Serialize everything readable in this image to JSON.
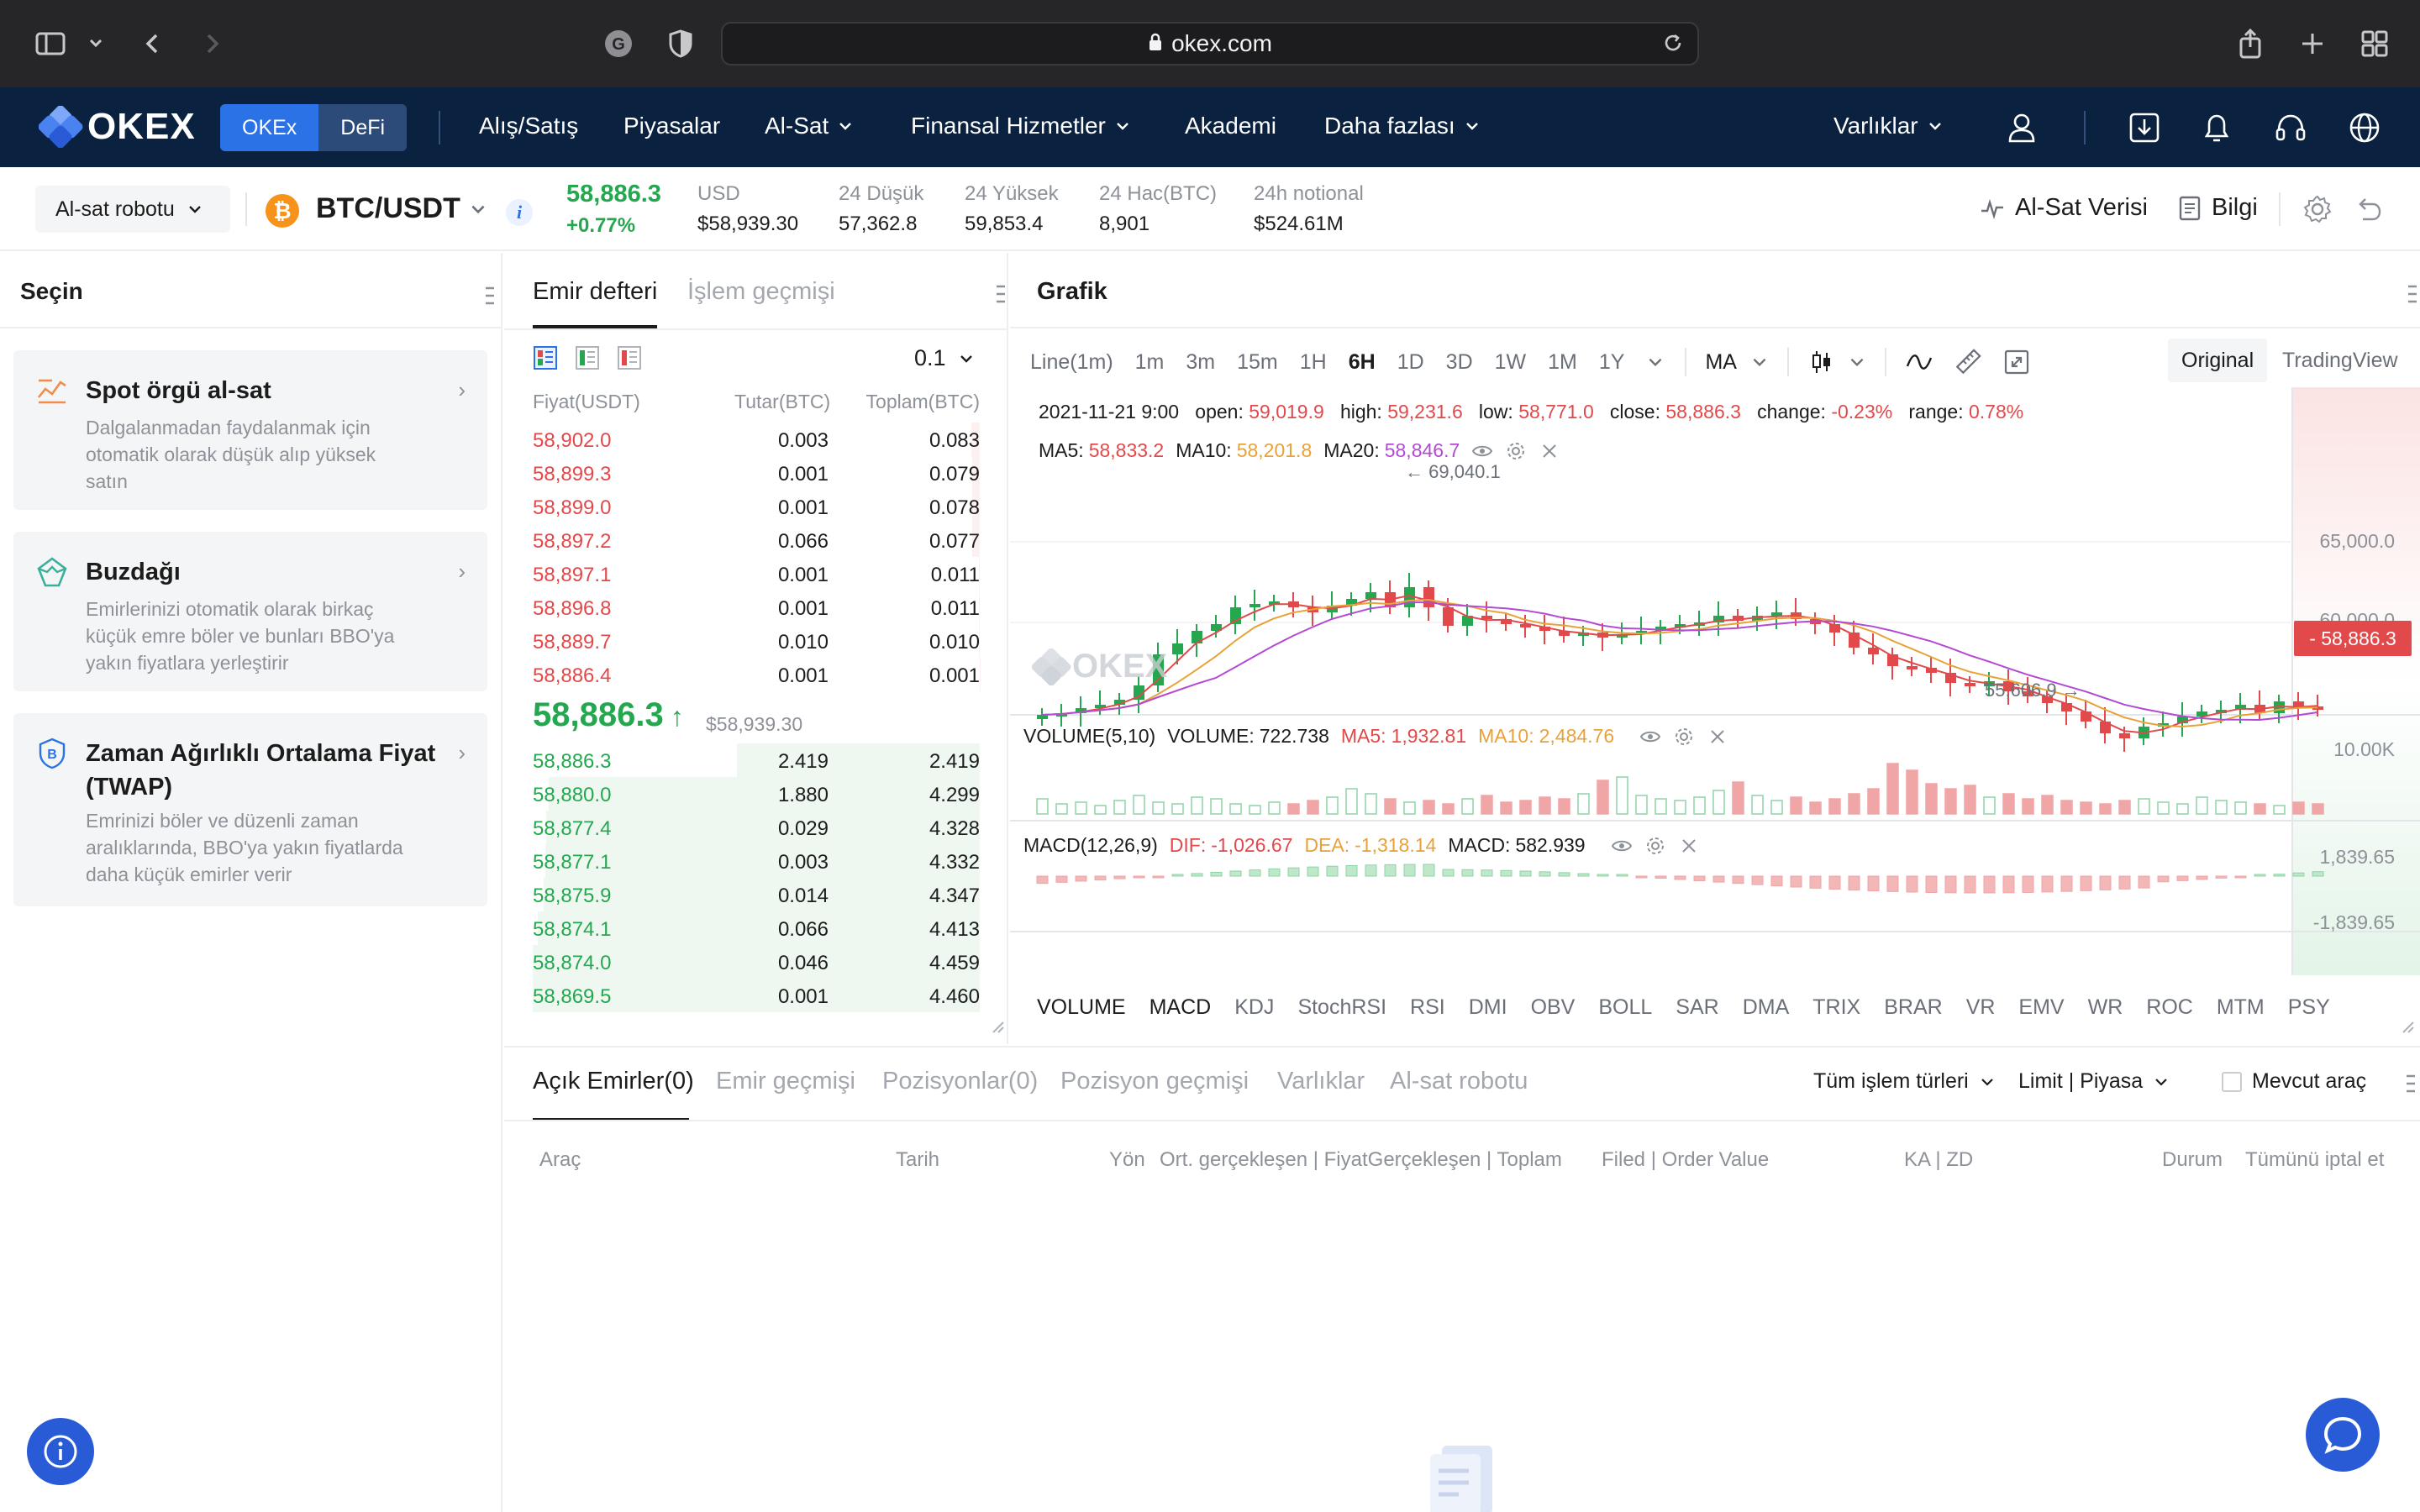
{
  "browser": {
    "url": "okex.com"
  },
  "nav": {
    "logo": "OKEX",
    "segments": [
      "OKEx",
      "DeFi"
    ],
    "items": [
      "Alış/Satış",
      "Piyasalar",
      "Al-Sat",
      "Finansal Hizmetler",
      "Akademi",
      "Daha fazlası"
    ],
    "assets": "Varlıklar"
  },
  "ticker": {
    "robot_select": "Al-sat robotu",
    "pair": "BTC/USDT",
    "last_price": "58,886.3",
    "change": "+0.77%",
    "stats": [
      {
        "label": "USD",
        "value": "$58,939.30"
      },
      {
        "label": "24 Düşük",
        "value": "57,362.8"
      },
      {
        "label": "24 Yüksek",
        "value": "59,853.4"
      },
      {
        "label": "24 Hac(BTC)",
        "value": "8,901"
      },
      {
        "label": "24h notional",
        "value": "$524.61M"
      }
    ],
    "trade_data": "Al-Sat Verisi",
    "info": "Bilgi"
  },
  "left_panel": {
    "title": "Seçin",
    "cards": [
      {
        "title": "Spot örgü al-sat",
        "desc": [
          "Dalgalanmadan faydalanmak için",
          "otomatik olarak düşük alıp yüksek",
          "satın"
        ]
      },
      {
        "title": "Buzdağı",
        "desc": [
          "Emirlerinizi otomatik olarak birkaç",
          "küçük emre böler ve bunları BBO'ya",
          "yakın fiyatlara yerleştirir"
        ]
      },
      {
        "title": "Zaman Ağırlıklı Ortalama Fiyat (TWAP)",
        "desc": [
          "Emrinizi böler ve düzenli zaman",
          "aralıklarında, BBO'ya yakın fiyatlarda",
          "daha küçük emirler verir"
        ]
      }
    ]
  },
  "order_book": {
    "tabs": [
      "Emir defteri",
      "İşlem geçmişi"
    ],
    "depth": "0.1",
    "headers": [
      "Fiyat(USDT)",
      "Tutar(BTC)",
      "Toplam(BTC)"
    ],
    "asks": [
      {
        "price": "58,902.0",
        "amount": "0.003",
        "total": "0.083"
      },
      {
        "price": "58,899.3",
        "amount": "0.001",
        "total": "0.079"
      },
      {
        "price": "58,899.0",
        "amount": "0.001",
        "total": "0.078"
      },
      {
        "price": "58,897.2",
        "amount": "0.066",
        "total": "0.077"
      },
      {
        "price": "58,897.1",
        "amount": "0.001",
        "total": "0.011"
      },
      {
        "price": "58,896.8",
        "amount": "0.001",
        "total": "0.011"
      },
      {
        "price": "58,889.7",
        "amount": "0.010",
        "total": "0.010"
      },
      {
        "price": "58,886.4",
        "amount": "0.001",
        "total": "0.001"
      }
    ],
    "mid_price": "58,886.3",
    "mid_usd": "$58,939.30",
    "bids": [
      {
        "price": "58,886.3",
        "amount": "2.419",
        "total": "2.419"
      },
      {
        "price": "58,880.0",
        "amount": "1.880",
        "total": "4.299"
      },
      {
        "price": "58,877.4",
        "amount": "0.029",
        "total": "4.328"
      },
      {
        "price": "58,877.1",
        "amount": "0.003",
        "total": "4.332"
      },
      {
        "price": "58,875.9",
        "amount": "0.014",
        "total": "4.347"
      },
      {
        "price": "58,874.1",
        "amount": "0.066",
        "total": "4.413"
      },
      {
        "price": "58,874.0",
        "amount": "0.046",
        "total": "4.459"
      },
      {
        "price": "58,869.5",
        "amount": "0.001",
        "total": "4.460"
      }
    ]
  },
  "chart": {
    "title": "Grafik",
    "timeframes": [
      "Line(1m)",
      "1m",
      "3m",
      "15m",
      "1H",
      "6H",
      "1D",
      "3D",
      "1W",
      "1M",
      "1Y"
    ],
    "selected_tf": "6H",
    "ma_select": "MA",
    "modes": [
      "Original",
      "TradingView"
    ],
    "ohlc": {
      "date": "2021-11-21 9:00",
      "open_label": "open:",
      "open": "59,019.9",
      "high_label": "high:",
      "high": "59,231.6",
      "low_label": "low:",
      "low": "58,771.0",
      "close_label": "close:",
      "close": "58,886.3",
      "change_label": "change:",
      "change": "-0.23%",
      "range_label": "range:",
      "range": "0.78%"
    },
    "ma": [
      {
        "label": "MA5:",
        "value": "58,833.2",
        "color": "#e1494b"
      },
      {
        "label": "MA10:",
        "value": "58,201.8",
        "color": "#e8a23a"
      },
      {
        "label": "MA20:",
        "value": "58,846.7",
        "color": "#b24bd1"
      }
    ],
    "high_marker": "← 69,040.1",
    "low_marker": "55,606.9 →",
    "price_axis": [
      "65,000.0",
      "60,000.0"
    ],
    "current_price": "- 58,886.3",
    "volume": {
      "title": "VOLUME(5,10)",
      "value_label": "VOLUME:",
      "value": "722.738",
      "ma5_label": "MA5:",
      "ma5": "1,932.81",
      "ma10_label": "MA10:",
      "ma10": "2,484.76",
      "axis": "10.00K"
    },
    "macd": {
      "title": "MACD(12,26,9)",
      "dif_label": "DIF:",
      "dif": "-1,026.67",
      "dea_label": "DEA:",
      "dea": "-1,318.14",
      "macd_label": "MACD:",
      "macd": "582.939",
      "axis_top": "1,839.65",
      "axis_bottom": "-1,839.65"
    },
    "indicators": [
      "VOLUME",
      "MACD",
      "KDJ",
      "StochRSI",
      "RSI",
      "DMI",
      "OBV",
      "BOLL",
      "SAR",
      "DMA",
      "TRIX",
      "BRAR",
      "VR",
      "EMV",
      "WR",
      "ROC",
      "MTM",
      "PSY"
    ],
    "watermark": "OKEX"
  },
  "orders": {
    "tabs": [
      "Açık Emirler(0)",
      "Emir geçmişi",
      "Pozisyonlar(0)",
      "Pozisyon geçmişi",
      "Varlıklar",
      "Al-sat robotu"
    ],
    "filters": [
      "Tüm işlem türleri",
      "Limit | Piyasa",
      "Mevcut araç"
    ],
    "columns": [
      "Araç",
      "Tarih",
      "Yön",
      "Ort. gerçekleşen | FiyatGerçekleşen | Toplam",
      "Filed | Order Value",
      "KA | ZD",
      "Durum",
      "Tümünü iptal et"
    ]
  },
  "colors": {
    "up": "#25a750",
    "down": "#e1494b",
    "brand": "#0b2140",
    "accent": "#2a72e5"
  }
}
